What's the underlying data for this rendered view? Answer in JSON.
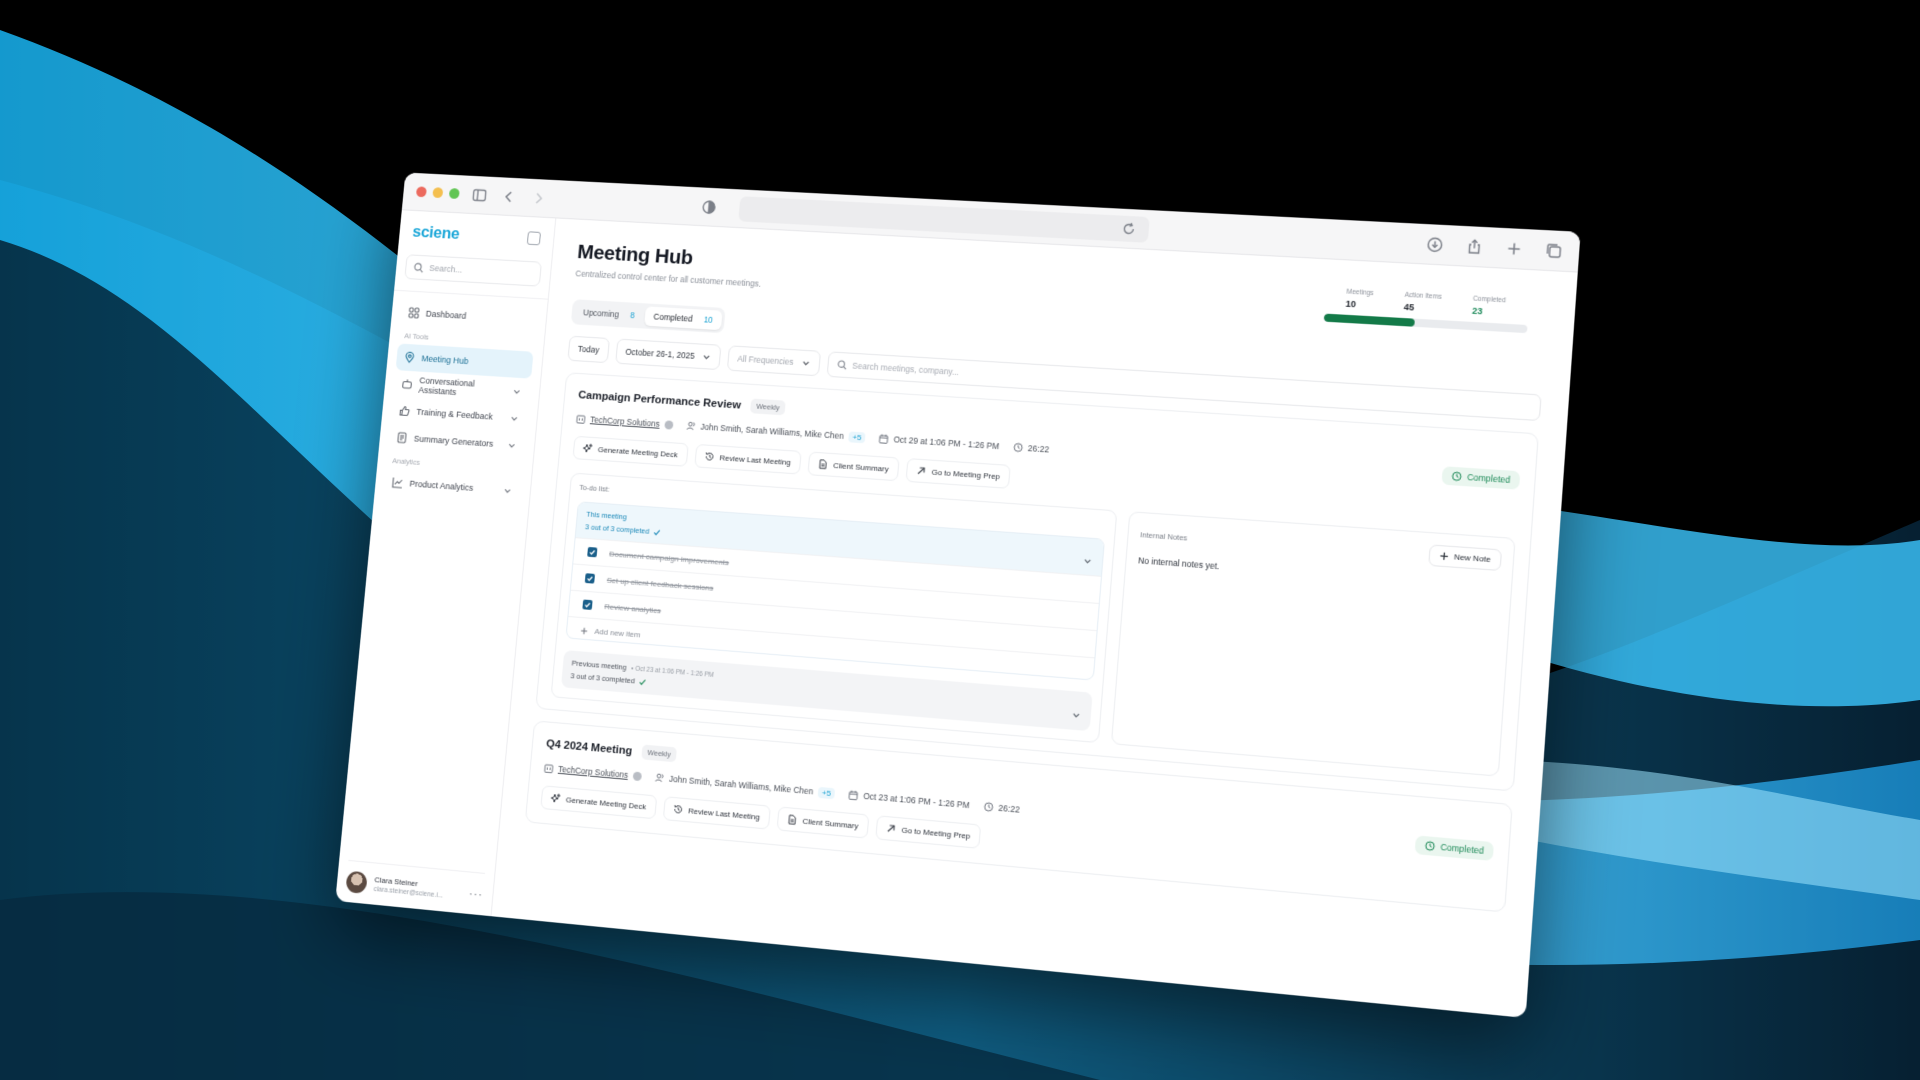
{
  "browser": {
    "address": ""
  },
  "sidebar": {
    "logo": "sciene",
    "search_placeholder": "Search...",
    "items": [
      {
        "label": "Dashboard"
      },
      {
        "label": "Meeting Hub"
      },
      {
        "label": "Conversational Assistants"
      },
      {
        "label": "Training & Feedback"
      },
      {
        "label": "Summary Generators"
      },
      {
        "label": "Product Analytics"
      }
    ],
    "sections": {
      "ai_tools": "AI Tools",
      "analytics": "Analytics"
    },
    "user": {
      "name": "Clara Steiner",
      "email": "clara.steiner@sciene.i..."
    }
  },
  "header": {
    "title": "Meeting Hub",
    "subtitle": "Centralized control center for all customer meetings."
  },
  "stats": {
    "meetings_label": "Meetings",
    "meetings_value": "10",
    "action_items_label": "Action Items",
    "action_items_value": "45",
    "completed_label": "Completed",
    "completed_value": "23",
    "progress_fraction": 0.45,
    "progress_color": "#137a48"
  },
  "tabs": {
    "upcoming_label": "Upcoming",
    "upcoming_count": "8",
    "completed_label": "Completed",
    "completed_count": "10"
  },
  "filters": {
    "today": "Today",
    "date_range": "October 26-1, 2025",
    "frequency": "All Frequencies",
    "search_placeholder": "Search meetings, company..."
  },
  "meetings": [
    {
      "title": "Campaign Performance Review",
      "frequency": "Weekly",
      "company": "TechCorp Solutions",
      "attendees": "John Smith, Sarah Williams, Mike Chen",
      "more": "+5",
      "datetime": "Oct 29 at 1:06 PM - 1:26 PM",
      "duration": "26:22",
      "status": "Completed",
      "actions": [
        "Generate Meeting Deck",
        "Review Last Meeting",
        "Client Summary",
        "Go to Meeting Prep"
      ],
      "todo": {
        "label": "To-do list:",
        "group_title": "This meeting",
        "group_sub": "3 out of 3 completed",
        "items": [
          "Document campaign improvements",
          "Set up client feedback sessions",
          "Review analytics"
        ],
        "add_label": "Add new item",
        "prev_title": "Previous meeting",
        "prev_date": "• Oct 23 at 1:06 PM - 1:26 PM",
        "prev_sub": "3 out of 3 completed"
      },
      "notes": {
        "title": "Internal Notes",
        "new_label": "New Note",
        "empty": "No internal notes yet."
      }
    },
    {
      "title": "Q4 2024 Meeting",
      "frequency": "Weekly",
      "company": "TechCorp Solutions",
      "attendees": "John Smith, Sarah Williams, Mike Chen",
      "more": "+5",
      "datetime": "Oct 23 at 1:06 PM - 1:26 PM",
      "duration": "26:22",
      "status": "Completed",
      "actions": [
        "Generate Meeting Deck",
        "Review Last Meeting",
        "Client Summary",
        "Go to Meeting Prep"
      ]
    }
  ],
  "colors": {
    "brand": "#19a6d8",
    "status_green": "#1e8a58",
    "checkbox": "#1a5f8a"
  }
}
